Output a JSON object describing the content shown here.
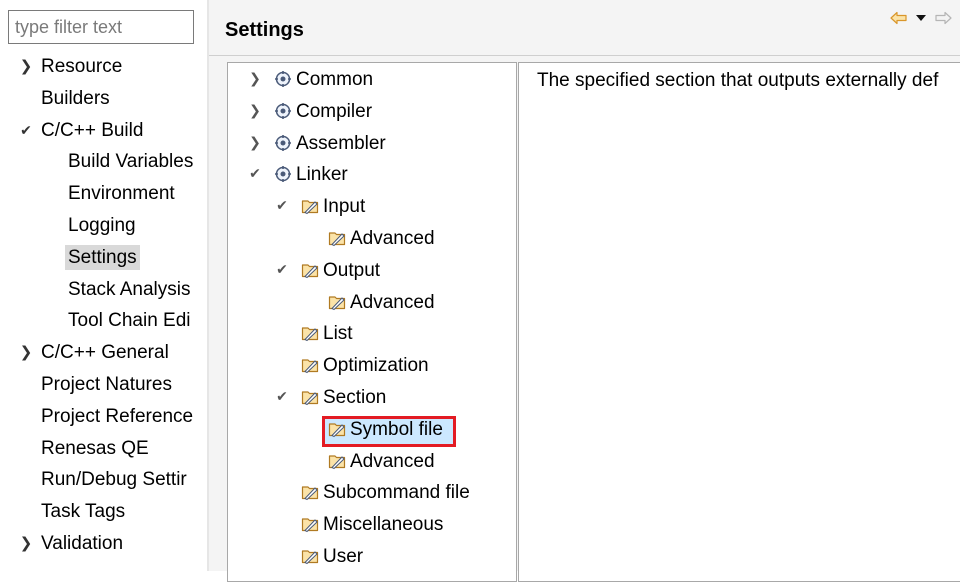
{
  "filter": {
    "placeholder": "type filter text",
    "value": ""
  },
  "nav": {
    "items": [
      {
        "label": "Resource",
        "twisty": "collapsed"
      },
      {
        "label": "Builders",
        "twisty": "none"
      },
      {
        "label": "C/C++ Build",
        "twisty": "expanded"
      },
      {
        "label": "Build Variables",
        "twisty": "none"
      },
      {
        "label": "Environment",
        "twisty": "none"
      },
      {
        "label": "Logging",
        "twisty": "none"
      },
      {
        "label": "Settings",
        "twisty": "none",
        "selected": true
      },
      {
        "label": "Stack Analysis",
        "twisty": "none"
      },
      {
        "label": "Tool Chain Edi",
        "twisty": "none"
      },
      {
        "label": "C/C++ General",
        "twisty": "collapsed"
      },
      {
        "label": "Project Natures",
        "twisty": "none"
      },
      {
        "label": "Project Reference",
        "twisty": "none"
      },
      {
        "label": "Renesas QE",
        "twisty": "none"
      },
      {
        "label": "Run/Debug Settir",
        "twisty": "none"
      },
      {
        "label": "Task Tags",
        "twisty": "none"
      },
      {
        "label": "Validation",
        "twisty": "collapsed"
      }
    ]
  },
  "header": {
    "title": "Settings",
    "back_icon": "arrow-back-icon",
    "menu_icon": "dropdown-triangle-icon",
    "forward_icon": "arrow-forward-icon"
  },
  "tool_tree": {
    "nodes": [
      {
        "label": "Common",
        "twisty": "collapsed",
        "icon": "tool-icon"
      },
      {
        "label": "Compiler",
        "twisty": "collapsed",
        "icon": "tool-icon"
      },
      {
        "label": "Assembler",
        "twisty": "collapsed",
        "icon": "tool-icon"
      },
      {
        "label": "Linker",
        "twisty": "expanded",
        "icon": "tool-icon"
      },
      {
        "label": "Input",
        "twisty": "expanded",
        "icon": "option-category-icon"
      },
      {
        "label": "Advanced",
        "twisty": "none",
        "icon": "option-category-icon"
      },
      {
        "label": "Output",
        "twisty": "expanded",
        "icon": "option-category-icon"
      },
      {
        "label": "Advanced",
        "twisty": "none",
        "icon": "option-category-icon"
      },
      {
        "label": "List",
        "twisty": "none",
        "icon": "option-category-icon"
      },
      {
        "label": "Optimization",
        "twisty": "none",
        "icon": "option-category-icon"
      },
      {
        "label": "Section",
        "twisty": "expanded",
        "icon": "option-category-icon"
      },
      {
        "label": "Symbol file",
        "twisty": "none",
        "icon": "option-category-icon",
        "selected": true
      },
      {
        "label": "Advanced",
        "twisty": "none",
        "icon": "option-category-icon"
      },
      {
        "label": "Subcommand file",
        "twisty": "none",
        "icon": "option-category-icon"
      },
      {
        "label": "Miscellaneous",
        "twisty": "none",
        "icon": "option-category-icon"
      },
      {
        "label": "User",
        "twisty": "none",
        "icon": "option-category-icon"
      }
    ]
  },
  "description": {
    "text": "The specified section that outputs externally def"
  },
  "colors": {
    "highlight_border": "#e31b23",
    "selection_bg": "#cce8ff",
    "nav_selected_bg": "#d9d9d9",
    "panel_bg": "#f4f4f4",
    "arrow_icon": "#e0a030"
  }
}
